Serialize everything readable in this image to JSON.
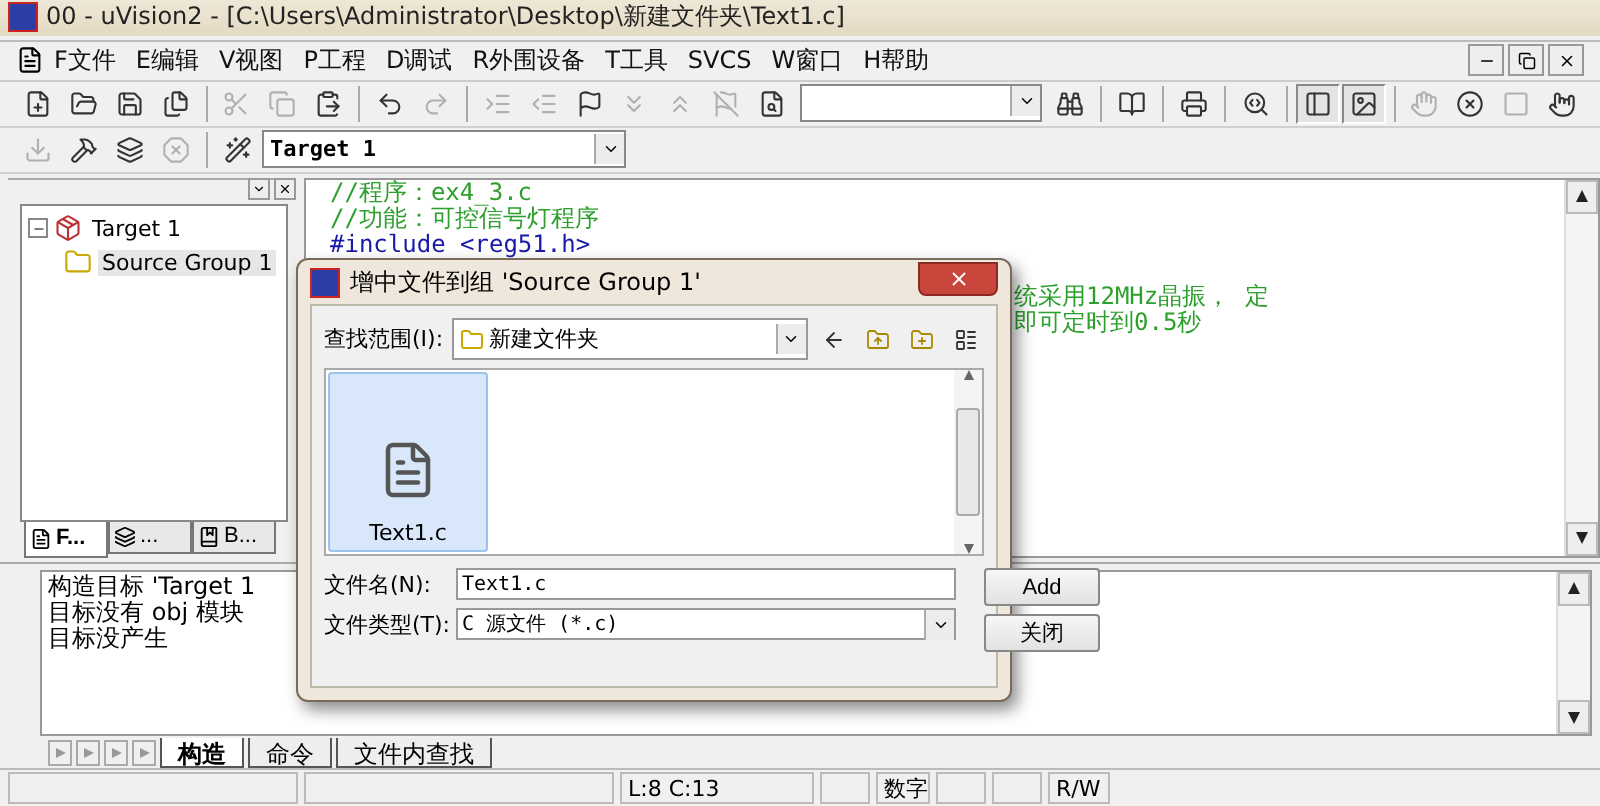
{
  "window": {
    "title": "00 - uVision2 - [C:\\Users\\Administrator\\Desktop\\新建文件夹\\Text1.c]"
  },
  "menu": [
    "F文件",
    "E编辑",
    "V视图",
    "P工程",
    "D调试",
    "R外围设备",
    "T工具",
    "SVCS",
    "W窗口",
    "H帮助"
  ],
  "toolbar_1": [
    {
      "kind": "button",
      "disabled": false,
      "pressed": false
    },
    {
      "kind": "button",
      "disabled": false,
      "pressed": false
    },
    {
      "kind": "button",
      "disabled": false,
      "pressed": false
    },
    {
      "kind": "button",
      "disabled": false,
      "pressed": false
    },
    {
      "kind": "separator"
    },
    {
      "kind": "button",
      "disabled": true,
      "pressed": false
    },
    {
      "kind": "button",
      "disabled": true,
      "pressed": false
    },
    {
      "kind": "button",
      "disabled": false,
      "pressed": false
    },
    {
      "kind": "separator"
    },
    {
      "kind": "button",
      "disabled": false,
      "pressed": false
    },
    {
      "kind": "button",
      "disabled": true,
      "pressed": false
    },
    {
      "kind": "separator"
    },
    {
      "kind": "button",
      "disabled": true,
      "pressed": false
    },
    {
      "kind": "button",
      "disabled": true,
      "pressed": false
    },
    {
      "kind": "button",
      "disabled": false,
      "pressed": false
    },
    {
      "kind": "button",
      "disabled": true,
      "pressed": false
    },
    {
      "kind": "button",
      "disabled": true,
      "pressed": false
    },
    {
      "kind": "button",
      "disabled": true,
      "pressed": false
    },
    {
      "kind": "button",
      "disabled": false,
      "pressed": false
    },
    {
      "kind": "combo"
    },
    {
      "kind": "button",
      "disabled": false,
      "pressed": false
    },
    {
      "kind": "separator"
    },
    {
      "kind": "button",
      "disabled": false,
      "pressed": false
    },
    {
      "kind": "separator"
    },
    {
      "kind": "button",
      "disabled": false,
      "pressed": false
    },
    {
      "kind": "separator"
    },
    {
      "kind": "button",
      "disabled": false,
      "pressed": false
    },
    {
      "kind": "separator"
    },
    {
      "kind": "button",
      "disabled": false,
      "pressed": true
    },
    {
      "kind": "button",
      "disabled": false,
      "pressed": true
    },
    {
      "kind": "separator"
    },
    {
      "kind": "button",
      "disabled": true,
      "pressed": false
    },
    {
      "kind": "button",
      "disabled": false,
      "pressed": false
    },
    {
      "kind": "button",
      "disabled": true,
      "pressed": false
    },
    {
      "kind": "button",
      "disabled": false,
      "pressed": false
    }
  ],
  "toolbar_2": {
    "buttons": [
      {
        "disabled": true
      },
      {
        "disabled": false
      },
      {
        "disabled": false
      },
      {
        "disabled": true
      }
    ],
    "target": "Target 1"
  },
  "project": {
    "tree": [
      {
        "label": "Target 1",
        "selected": false,
        "expanded": true,
        "children": [
          {
            "label": "Source Group 1",
            "selected": true
          }
        ]
      }
    ],
    "tabs": [
      {
        "label": "F...",
        "selected": true
      },
      {
        "label": "...",
        "selected": false
      },
      {
        "label": "B...",
        "selected": false
      }
    ]
  },
  "editor": {
    "lines": [
      {
        "kind": "comment",
        "text": "//程序：ex4_3.c"
      },
      {
        "kind": "comment",
        "text": "//功能：可控信号灯程序"
      },
      {
        "kind": "directive",
        "text": "#include <reg51.h>"
      },
      {
        "kind": "covered",
        "text": "统采用12MHz晶振， 定"
      },
      {
        "kind": "covered",
        "text": "即可定时到0.5秒"
      }
    ]
  },
  "output": {
    "lines": [
      "构造目标 'Target 1",
      "目标没有 obj 模块",
      "目标没产生"
    ],
    "tabs": [
      {
        "label": "构造",
        "selected": true
      },
      {
        "label": "命令",
        "selected": false
      },
      {
        "label": "文件内查找",
        "selected": false
      }
    ]
  },
  "status_bar": {
    "position": "L:8 C:13",
    "num": "数字",
    "mode": "R/W"
  },
  "dialog": {
    "title": "增中文件到组 'Source Group 1'",
    "look_in_label": "查找范围(I):",
    "look_in": "新建文件夹",
    "files": [
      {
        "name": "Text1.c",
        "selected": true
      }
    ],
    "file_name_label": "文件名(N):",
    "file_name": "Text1.c",
    "file_type_label": "文件类型(T):",
    "file_type": "C 源文件 (*.c)",
    "buttons": [
      "Add",
      "关闭"
    ]
  }
}
